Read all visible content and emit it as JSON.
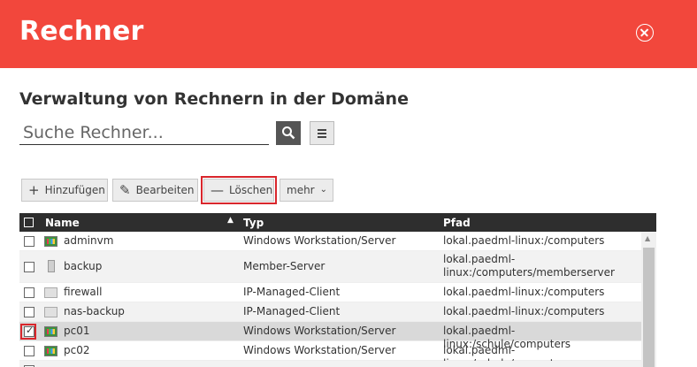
{
  "header": {
    "title": "Rechner"
  },
  "section": {
    "title": "Verwaltung von Rechnern in der Domäne"
  },
  "search": {
    "placeholder": "Suche Rechner..."
  },
  "toolbar": {
    "add_label": "Hinzufügen",
    "edit_label": "Bearbeiten",
    "delete_label": "Löschen",
    "more_label": "mehr"
  },
  "grid": {
    "columns": [
      "Name",
      "Typ",
      "Pfad"
    ],
    "rows": [
      {
        "name": "adminvm",
        "type": "Windows Workstation/Server",
        "path": "lokal.paedml-linux:/computers",
        "icon": "windows-computer-icon",
        "checked": false
      },
      {
        "name": "backup",
        "type": "Member-Server",
        "path1": "lokal.paedml-",
        "path2": "linux:/computers/memberserver",
        "icon": "server-icon",
        "checked": false
      },
      {
        "name": "firewall",
        "type": "IP-Managed-Client",
        "path": "lokal.paedml-linux:/computers",
        "icon": "ip-client-icon",
        "checked": false
      },
      {
        "name": "nas-backup",
        "type": "IP-Managed-Client",
        "path": "lokal.paedml-linux:/computers",
        "icon": "ip-client-icon",
        "checked": false
      },
      {
        "name": "pc01",
        "type": "Windows Workstation/Server",
        "path": "lokal.paedml-linux:/schule/computers",
        "icon": "windows-computer-icon",
        "checked": true
      },
      {
        "name": "pc02",
        "type": "Windows Workstation/Server",
        "path": "lokal.paedml-linux:/schule/computers",
        "icon": "windows-computer-icon",
        "checked": false
      }
    ]
  },
  "colors": {
    "header": "#f2473c",
    "highlight": "#d9262c",
    "grid_header": "#2e2e2e"
  }
}
